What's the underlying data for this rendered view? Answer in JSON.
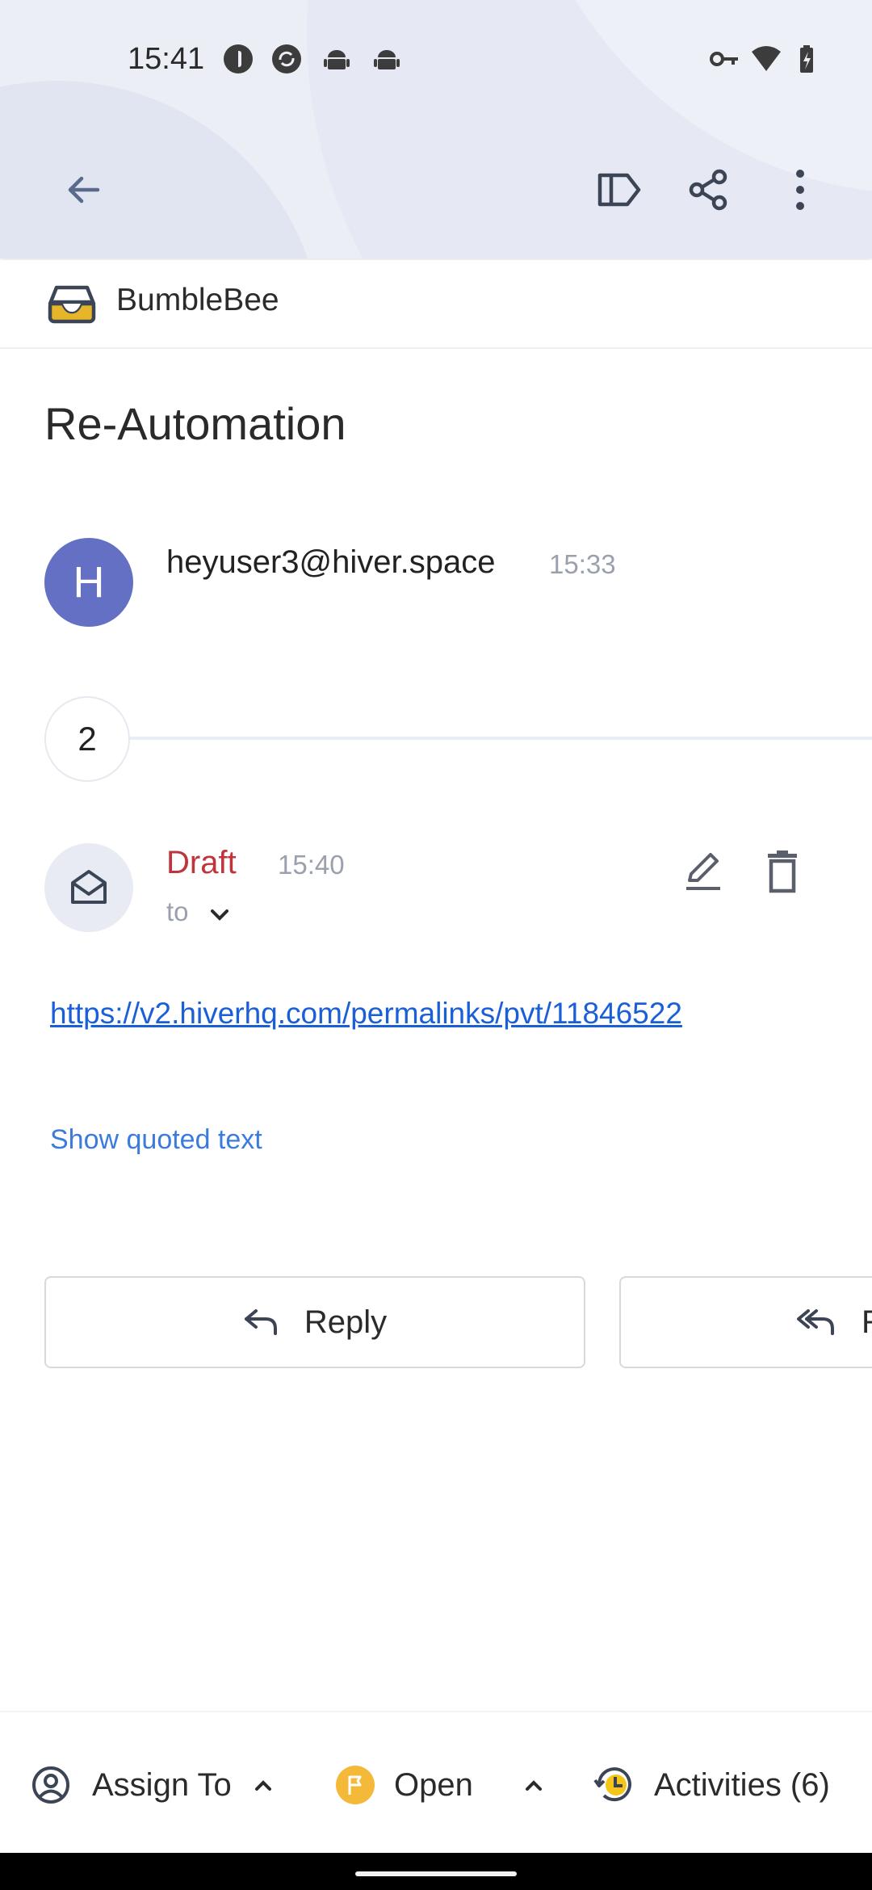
{
  "status_bar": {
    "time": "15:41",
    "icons": [
      "circle-app-icon",
      "sync-app-icon",
      "android-icon",
      "android-icon",
      "vpn-key-icon",
      "wifi-icon",
      "battery-icon"
    ]
  },
  "toolbar": {
    "icons": [
      "back-arrow-icon",
      "label-icon",
      "share-icon",
      "more-vert-icon"
    ]
  },
  "inbox": {
    "name": "BumbleBee",
    "icon": "inbox-tray-icon",
    "icon_color": "#e7b52a"
  },
  "email": {
    "subject": "Re-Automation",
    "sender": {
      "avatar_letter": "H",
      "avatar_color": "#6370c4",
      "address": "heyuser3@hiver.space",
      "time": "15:33"
    },
    "collapsed_count": "2",
    "draft": {
      "label": "Draft",
      "time": "15:40",
      "to_label": "to",
      "body_link": "https://v2.hiverhq.com/permalinks/pvt/11846522",
      "show_quoted": "Show quoted text"
    }
  },
  "actions": {
    "reply": "Reply",
    "reply_all": "Reply all"
  },
  "bottom_bar": {
    "assign": "Assign To",
    "status": "Open",
    "status_color": "#f5b93a",
    "activities": "Activities (6)"
  },
  "colors": {
    "accent": "#3a7bdc",
    "draft": "#c0343c"
  }
}
